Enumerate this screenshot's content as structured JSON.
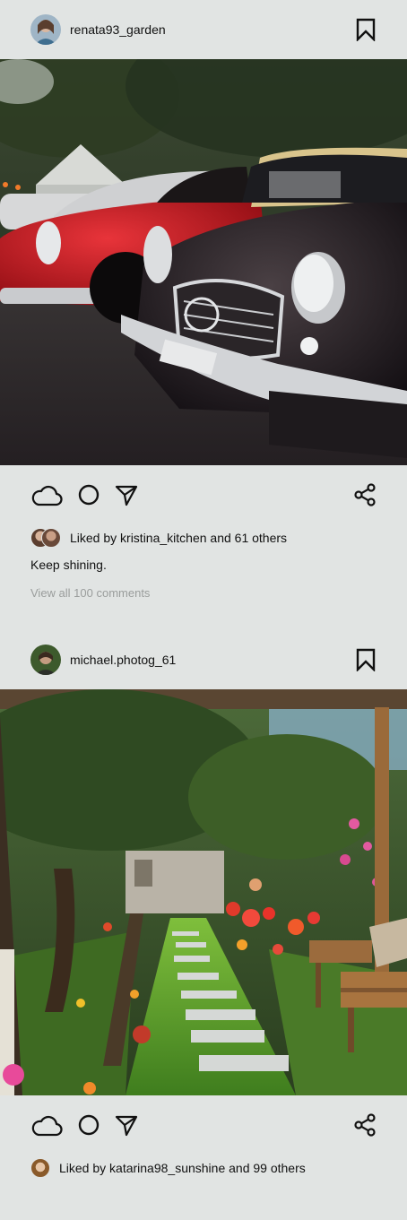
{
  "posts": [
    {
      "username": "renata93_garden",
      "likes_text": "Liked by kristina_kitchen and 61 others",
      "caption": "Keep shining.",
      "comments_link": "View all 100 comments"
    },
    {
      "username": "michael.photog_61",
      "likes_text": "Liked by katarina98_sunshine and 99 others"
    }
  ],
  "icons": {
    "bookmark": "bookmark-icon",
    "like": "cloud-icon",
    "comment": "circle-icon",
    "send": "paper-plane-icon",
    "share": "share-icon"
  },
  "colors": {
    "background": "#e1e4e3",
    "text": "#111111",
    "muted_text": "#9a9d9c"
  }
}
